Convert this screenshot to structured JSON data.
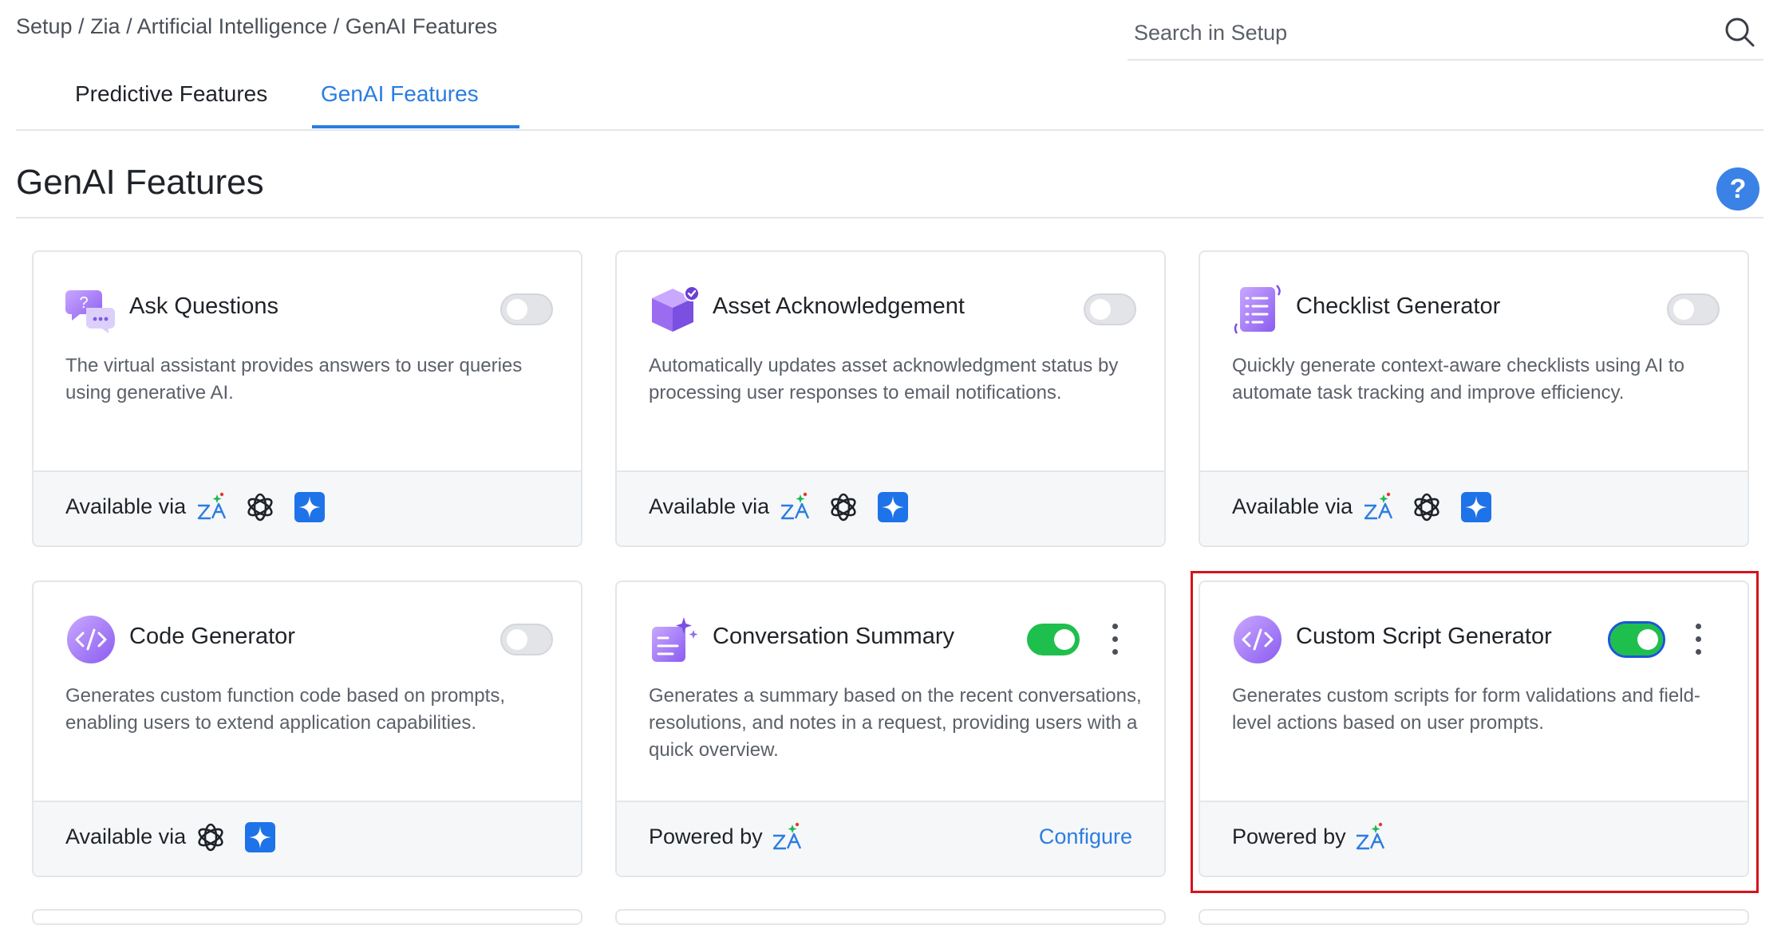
{
  "breadcrumb": "Setup / Zia / Artificial Intelligence / GenAI Features",
  "search": {
    "placeholder": "Search in Setup"
  },
  "tabs": [
    {
      "label": "Predictive Features",
      "active": false
    },
    {
      "label": "GenAI Features",
      "active": true
    }
  ],
  "page_title": "GenAI Features",
  "help_label": "?",
  "colors": {
    "accent": "#2a7de1",
    "toggle_on": "#1fbf4d",
    "highlight": "#d4141c",
    "icon_purple": "#9b6cf0"
  },
  "cards": [
    {
      "title": "Ask Questions",
      "description": "The virtual assistant provides answers to user queries using generative AI.",
      "icon": "chat-question-icon",
      "enabled": false,
      "footer_label": "Available via",
      "providers": [
        "zia-icon",
        "openai-icon",
        "gemini-icon"
      ]
    },
    {
      "title": "Asset Acknowledgement",
      "description": "Automatically updates asset acknowledgment status by processing user responses to email notifications.",
      "icon": "cube-check-icon",
      "enabled": false,
      "footer_label": "Available via",
      "providers": [
        "zia-icon",
        "openai-icon",
        "gemini-icon"
      ]
    },
    {
      "title": "Checklist Generator",
      "description": "Quickly generate context-aware checklists using AI to automate task tracking and improve efficiency.",
      "icon": "checklist-icon",
      "enabled": false,
      "footer_label": "Available via",
      "providers": [
        "zia-icon",
        "openai-icon",
        "gemini-icon"
      ]
    },
    {
      "title": "Code Generator",
      "description": "Generates custom function code based on prompts, enabling users to extend application capabilities.",
      "icon": "code-icon",
      "enabled": false,
      "footer_label": "Available via",
      "providers": [
        "openai-icon",
        "gemini-icon"
      ]
    },
    {
      "title": "Conversation Summary",
      "description": "Generates a summary based on the recent conversations, resolutions, and notes in a request, providing users with a quick overview.",
      "icon": "summary-sparkle-icon",
      "enabled": true,
      "footer_label": "Powered by",
      "providers": [
        "zia-icon"
      ],
      "action_label": "Configure"
    },
    {
      "title": "Custom Script Generator",
      "description": "Generates custom scripts for form validations and field-level actions based on user prompts.",
      "icon": "code-icon",
      "enabled": true,
      "footer_label": "Powered by",
      "providers": [
        "zia-icon"
      ]
    }
  ]
}
